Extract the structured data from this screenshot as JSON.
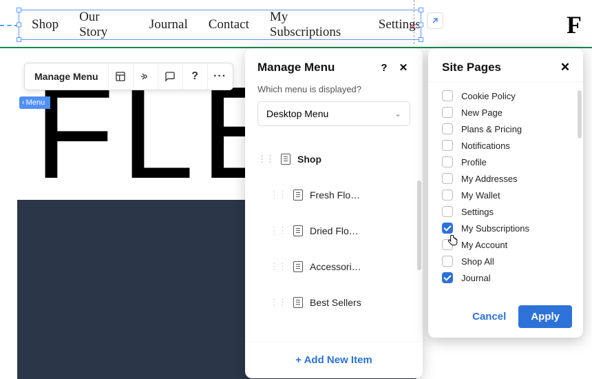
{
  "nav": {
    "items": [
      "Shop",
      "Our Story",
      "Journal",
      "Contact",
      "My Subscriptions",
      "Settings"
    ]
  },
  "logo": "F",
  "toolbar": {
    "manage_label": "Manage Menu"
  },
  "crumb": {
    "label": "Menu"
  },
  "manage_panel": {
    "title": "Manage Menu",
    "question": "Which menu is displayed?",
    "selected_menu": "Desktop Menu",
    "items": [
      {
        "label": "Shop",
        "level": 0
      },
      {
        "label": "Fresh Flo…",
        "level": 1
      },
      {
        "label": "Dried Flo…",
        "level": 1
      },
      {
        "label": "Accessori…",
        "level": 1
      },
      {
        "label": "Best Sellers",
        "level": 1
      }
    ],
    "add_new": "+ Add New Item"
  },
  "site_panel": {
    "title": "Site Pages",
    "pages": [
      {
        "label": "Cookie Policy",
        "checked": false
      },
      {
        "label": "New Page",
        "checked": false
      },
      {
        "label": "Plans & Pricing",
        "checked": false
      },
      {
        "label": "Notifications",
        "checked": false
      },
      {
        "label": "Profile",
        "checked": false
      },
      {
        "label": "My Addresses",
        "checked": false
      },
      {
        "label": "My Wallet",
        "checked": false
      },
      {
        "label": "Settings",
        "checked": false
      },
      {
        "label": "My Subscriptions",
        "checked": true
      },
      {
        "label": "My Account",
        "checked": false
      },
      {
        "label": "Shop All",
        "checked": false
      },
      {
        "label": "Journal",
        "checked": true
      }
    ],
    "cancel": "Cancel",
    "apply": "Apply"
  },
  "bg_text": "FLE"
}
